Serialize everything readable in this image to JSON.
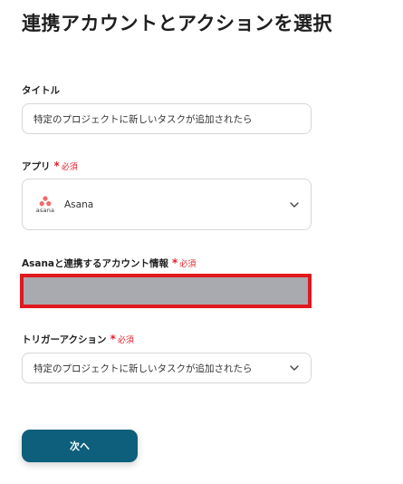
{
  "page": {
    "title": "連携アカウントとアクションを選択"
  },
  "form": {
    "title_field": {
      "label": "タイトル",
      "value": "特定のプロジェクトに新しいタスクが追加されたら"
    },
    "app_field": {
      "label": "アプリ",
      "required_mark": "*",
      "required_text": "必須",
      "value": "Asana",
      "logo_word": "asana",
      "icon": "asana-logo-icon"
    },
    "account_field": {
      "label": "Asanaと連携するアカウント情報",
      "required_mark": "*",
      "required_text": "必須"
    },
    "trigger_field": {
      "label": "トリガーアクション",
      "required_mark": "*",
      "required_text": "必須",
      "value": "特定のプロジェクトに新しいタスクが追加されたら",
      "icon": "chevron-down-icon"
    },
    "next_button": {
      "label": "次へ"
    }
  },
  "colors": {
    "accent": "#0d5f7b",
    "required": "#e0212b",
    "highlight_border": "#e0191f",
    "masked_fill": "#a9a9b0",
    "asana_coral": "#f06a6a"
  }
}
